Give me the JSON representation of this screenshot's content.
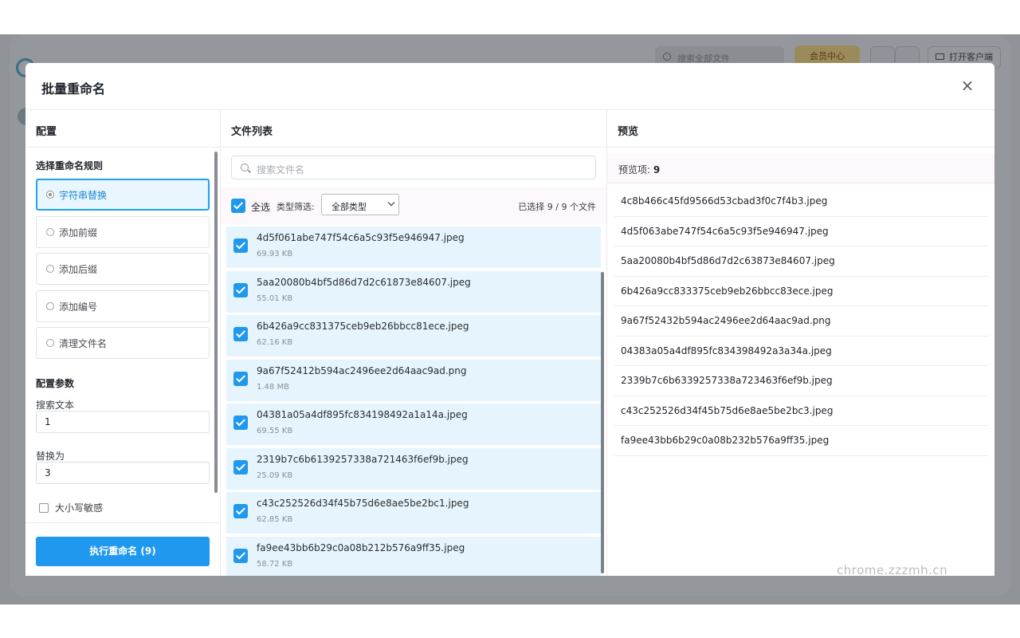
{
  "background": {
    "search_placeholder": "搜索全部文件",
    "vip_label": "会员中心",
    "client_label": "打开客户端"
  },
  "modal": {
    "title": "批量重命名",
    "close_label": "×"
  },
  "config": {
    "heading": "配置",
    "rules_title": "选择重命名规则",
    "rules": [
      {
        "label": "字符串替换",
        "active": true
      },
      {
        "label": "添加前缀",
        "active": false
      },
      {
        "label": "添加后缀",
        "active": false
      },
      {
        "label": "添加编号",
        "active": false
      },
      {
        "label": "清理文件名",
        "active": false
      }
    ],
    "params_title": "配置参数",
    "search_text_label": "搜索文本",
    "search_text_value": "1",
    "replace_label": "替换为",
    "replace_value": "3",
    "case_sensitive_label": "大小写敏感",
    "case_sensitive_checked": false,
    "run_button": "执行重命名 (9)"
  },
  "files": {
    "heading": "文件列表",
    "search_placeholder": "搜索文件名",
    "select_all_label": "全选",
    "type_filter_label": "类型筛选:",
    "type_filter_value": "全部类型",
    "selected_count": "已选择 9 / 9 个文件",
    "items": [
      {
        "name": "4d5f061abe747f54c6a5c93f5e946947.jpeg",
        "size": "69.93 KB"
      },
      {
        "name": "5aa20080b4bf5d86d7d2c61873e84607.jpeg",
        "size": "55.01 KB"
      },
      {
        "name": "6b426a9cc831375ceb9eb26bbcc81ece.jpeg",
        "size": "62.16 KB"
      },
      {
        "name": "9a67f52412b594ac2496ee2d64aac9ad.png",
        "size": "1.48 MB"
      },
      {
        "name": "04381a05a4df895fc834198492a1a14a.jpeg",
        "size": "69.55 KB"
      },
      {
        "name": "2319b7c6b6139257338a721463f6ef9b.jpeg",
        "size": "25.09 KB"
      },
      {
        "name": "c43c252526d34f45b75d6e8ae5be2bc1.jpeg",
        "size": "62.85 KB"
      },
      {
        "name": "fa9ee43bb6b29c0a08b212b576a9ff35.jpeg",
        "size": "58.72 KB"
      }
    ]
  },
  "preview": {
    "heading": "预览",
    "count_label": "预览项:",
    "count_value": "9",
    "items": [
      "4c8b466c45fd9566d53cbad3f0c7f4b3.jpeg",
      "4d5f063abe747f54c6a5c93f5e946947.jpeg",
      "5aa20080b4bf5d86d7d2c63873e84607.jpeg",
      "6b426a9cc833375ceb9eb26bbcc83ece.jpeg",
      "9a67f52432b594ac2496ee2d64aac9ad.png",
      "04383a05a4df895fc834398492a3a34a.jpeg",
      "2339b7c6b6339257338a723463f6ef9b.jpeg",
      "c43c252526d34f45b75d6e8ae5be2bc3.jpeg",
      "fa9ee43bb6b29c0a08b232b576a9ff35.jpeg"
    ]
  },
  "watermark": "chrome.zzzmh.cn",
  "colors": {
    "accent": "#1f98ee",
    "active_rule_bg": "#e9f6fd",
    "file_row_bg": "#e6f5fd",
    "overlay": "#909498"
  }
}
